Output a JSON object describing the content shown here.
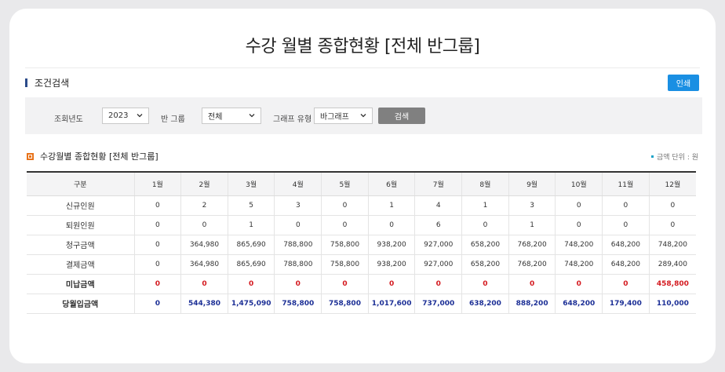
{
  "page": {
    "title": "수강 월별 종합현황 [전체 반그룹]"
  },
  "search": {
    "section_label": "조건검색",
    "print_label": "인쇄",
    "year_label": "조회년도",
    "year_value": "2023",
    "class_label": "반 그룹",
    "class_value": "전체",
    "graph_label": "그래프 유형",
    "graph_value": "바그래프",
    "search_label": "검색"
  },
  "summary": {
    "title": "수강월별 종합현황 [전체 반그룹]",
    "unit_note": "금액 단위 : 원",
    "columns": [
      "구분",
      "1월",
      "2월",
      "3월",
      "4월",
      "5월",
      "6월",
      "7월",
      "8월",
      "9월",
      "10월",
      "11월",
      "12월"
    ],
    "rows": [
      {
        "label": "신규인원",
        "values": [
          "0",
          "2",
          "5",
          "3",
          "0",
          "1",
          "4",
          "1",
          "3",
          "0",
          "0",
          "0"
        ]
      },
      {
        "label": "퇴원인원",
        "values": [
          "0",
          "0",
          "1",
          "0",
          "0",
          "0",
          "6",
          "0",
          "1",
          "0",
          "0",
          "0"
        ]
      },
      {
        "label": "청구금액",
        "values": [
          "0",
          "364,980",
          "865,690",
          "788,800",
          "758,800",
          "938,200",
          "927,000",
          "658,200",
          "768,200",
          "748,200",
          "648,200",
          "748,200"
        ]
      },
      {
        "label": "결제금액",
        "values": [
          "0",
          "364,980",
          "865,690",
          "788,800",
          "758,800",
          "938,200",
          "927,000",
          "658,200",
          "768,200",
          "748,200",
          "648,200",
          "289,400"
        ]
      },
      {
        "label": "미납금액",
        "values": [
          "0",
          "0",
          "0",
          "0",
          "0",
          "0",
          "0",
          "0",
          "0",
          "0",
          "0",
          "458,800"
        ]
      },
      {
        "label": "당월입금액",
        "values": [
          "0",
          "544,380",
          "1,475,090",
          "758,800",
          "758,800",
          "1,017,600",
          "737,000",
          "638,200",
          "888,200",
          "648,200",
          "179,400",
          "110,000"
        ]
      }
    ]
  },
  "colors": {
    "accent_blue": "#1a8fe3",
    "unpaid_red": "#d4191f",
    "deposit_navy": "#1c2f96",
    "section_orange": "#e8731a"
  }
}
